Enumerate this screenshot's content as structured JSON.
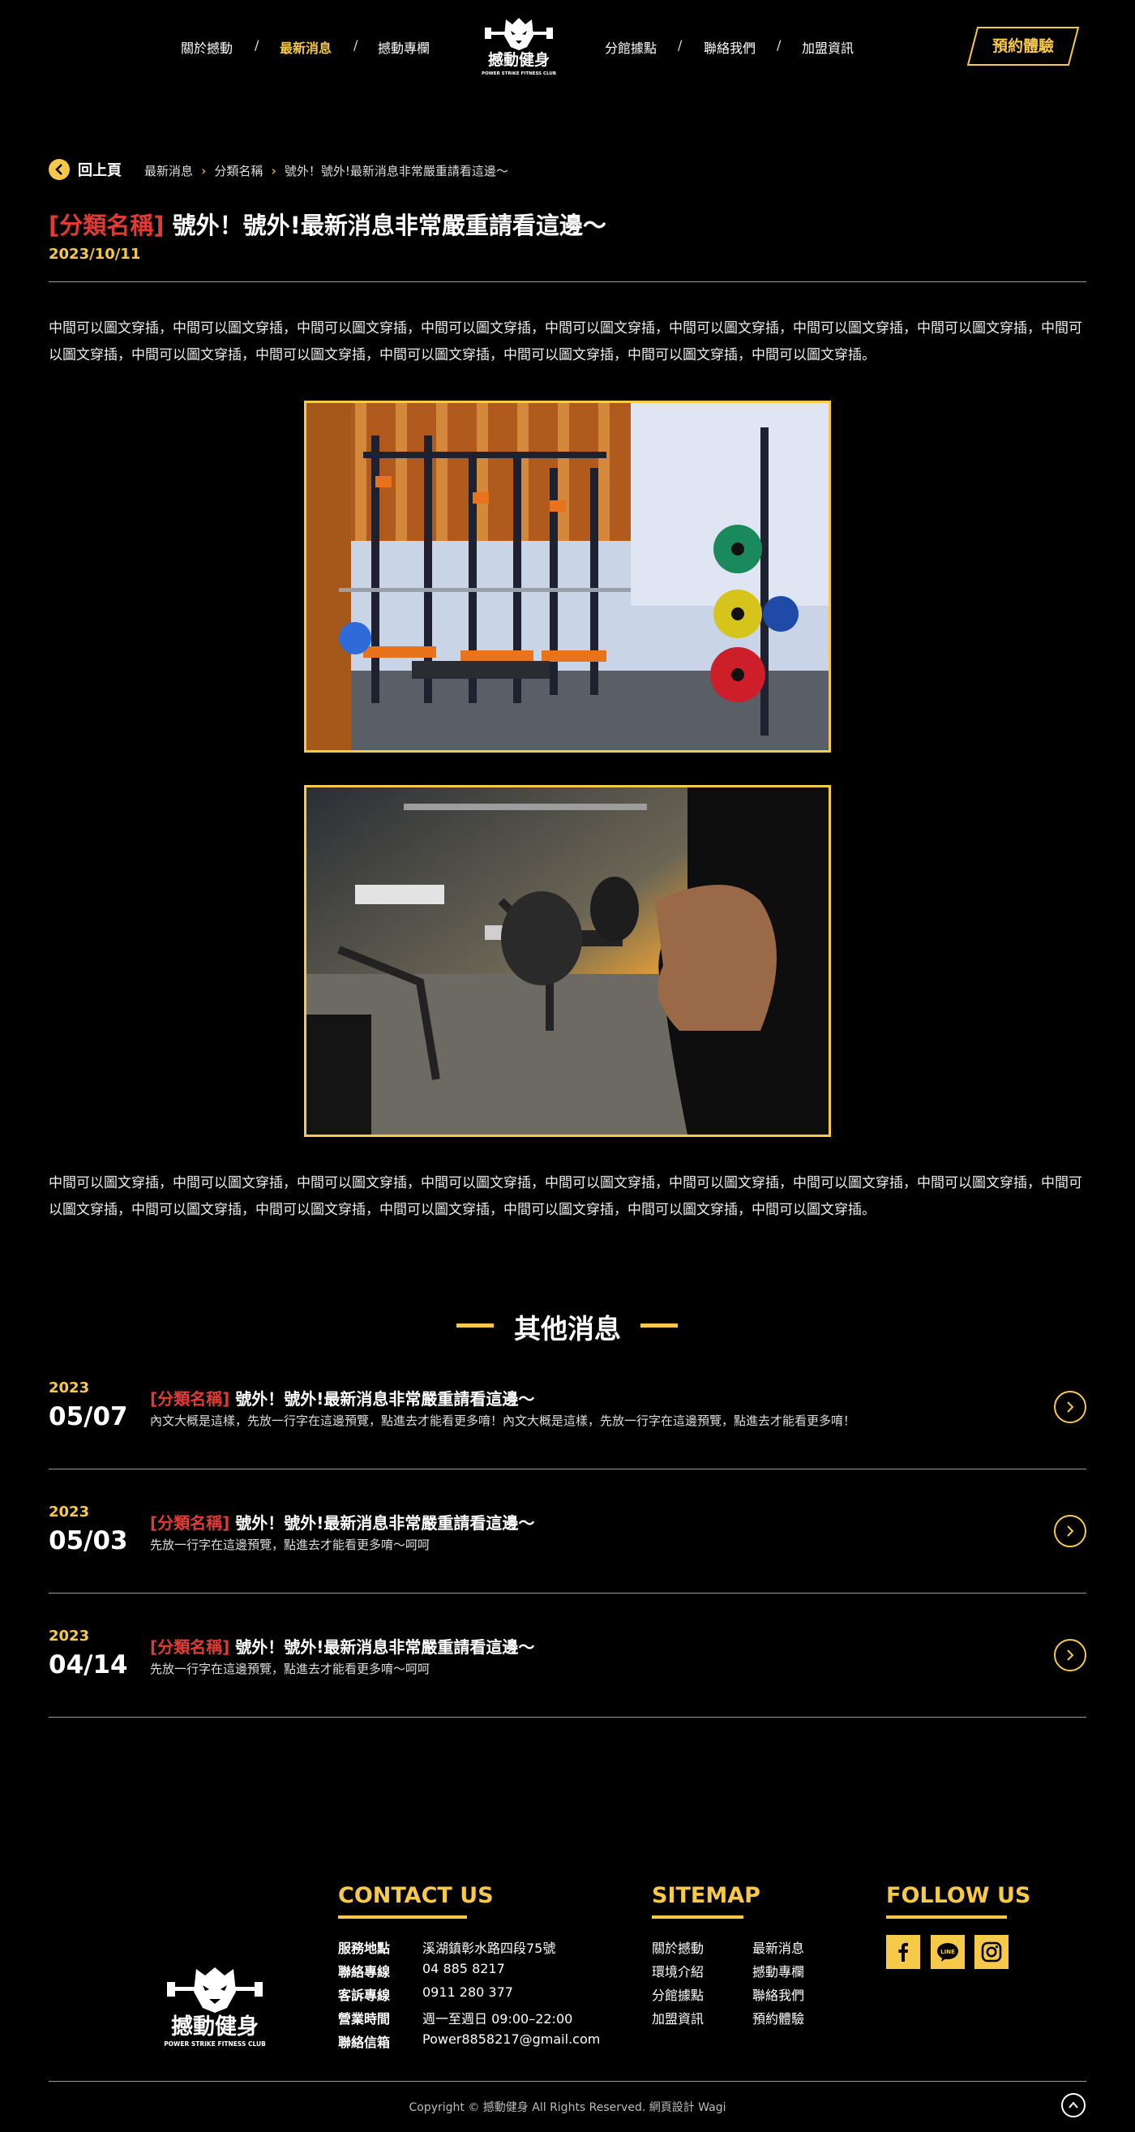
{
  "nav": {
    "left": [
      "關於撼動",
      "最新消息",
      "撼動專欄"
    ],
    "right": [
      "分館據點",
      "聯絡我們",
      "加盟資訊"
    ],
    "sep": "/",
    "cta": "預約體驗",
    "logo_text": "撼動健身",
    "logo_sub": "POWER STRIKE FITNESS CLUB"
  },
  "breadcrumb": {
    "back": "回上頁",
    "items": [
      "最新消息",
      "分類名稱",
      "號外！號外!最新消息非常嚴重請看這邊～"
    ]
  },
  "article": {
    "category": "[分類名稱]",
    "title": " 號外！號外!最新消息非常嚴重請看這邊～",
    "date": "2023/10/11",
    "para1": "中間可以圖文穿插，中間可以圖文穿插，中間可以圖文穿插，中間可以圖文穿插，中間可以圖文穿插，中間可以圖文穿插，中間可以圖文穿插，中間可以圖文穿插，中間可以圖文穿插，中間可以圖文穿插，中間可以圖文穿插，中間可以圖文穿插，中間可以圖文穿插，中間可以圖文穿插，中間可以圖文穿插。",
    "para2": "中間可以圖文穿插，中間可以圖文穿插，中間可以圖文穿插，中間可以圖文穿插，中間可以圖文穿插，中間可以圖文穿插，中間可以圖文穿插，中間可以圖文穿插，中間可以圖文穿插，中間可以圖文穿插，中間可以圖文穿插，中間可以圖文穿插，中間可以圖文穿插，中間可以圖文穿插，中間可以圖文穿插。"
  },
  "other_news": {
    "heading": "其他消息",
    "items": [
      {
        "year": "2023",
        "day": "05/07",
        "category": "[分類名稱]",
        "title": " 號外！號外!最新消息非常嚴重請看這邊～",
        "desc": "內文大概是這樣，先放一行字在這邊預覽，點進去才能看更多唷！內文大概是這樣，先放一行字在這邊預覽，點進去才能看更多唷！"
      },
      {
        "year": "2023",
        "day": "05/03",
        "category": "[分類名稱]",
        "title": " 號外！號外!最新消息非常嚴重請看這邊～",
        "desc": "先放一行字在這邊預覽，點進去才能看更多唷～呵呵"
      },
      {
        "year": "2023",
        "day": "04/14",
        "category": "[分類名稱]",
        "title": " 號外！號外!最新消息非常嚴重請看這邊～",
        "desc": "先放一行字在這邊預覽，點進去才能看更多唷～呵呵"
      }
    ]
  },
  "footer": {
    "contact_heading": "CONTACT US",
    "contact": [
      {
        "label": "服務地點",
        "value": "溪湖鎮彰水路四段75號"
      },
      {
        "label": "聯絡專線",
        "value": "04 885 8217"
      },
      {
        "label": "客訴專線",
        "value": "0911 280 377"
      },
      {
        "label": "營業時間",
        "value": "週一至週日 09:00–22:00"
      },
      {
        "label": "聯絡信箱",
        "value": "Power8858217@gmail.com"
      }
    ],
    "sitemap_heading": "SITEMAP",
    "sitemap": [
      "關於撼動",
      "最新消息",
      "環境介紹",
      "撼動專欄",
      "分館據點",
      "聯絡我們",
      "加盟資訊",
      "預約體驗"
    ],
    "follow_heading": "FOLLOW US",
    "social": [
      "facebook-icon",
      "line-icon",
      "instagram-icon"
    ],
    "line_text": "LINE",
    "copyright": "Copyright © 撼動健身 All Rights Reserved. 網頁設計 Wagi"
  },
  "colors": {
    "accent": "#f7c948",
    "category": "#e23b35",
    "background": "#000000"
  }
}
